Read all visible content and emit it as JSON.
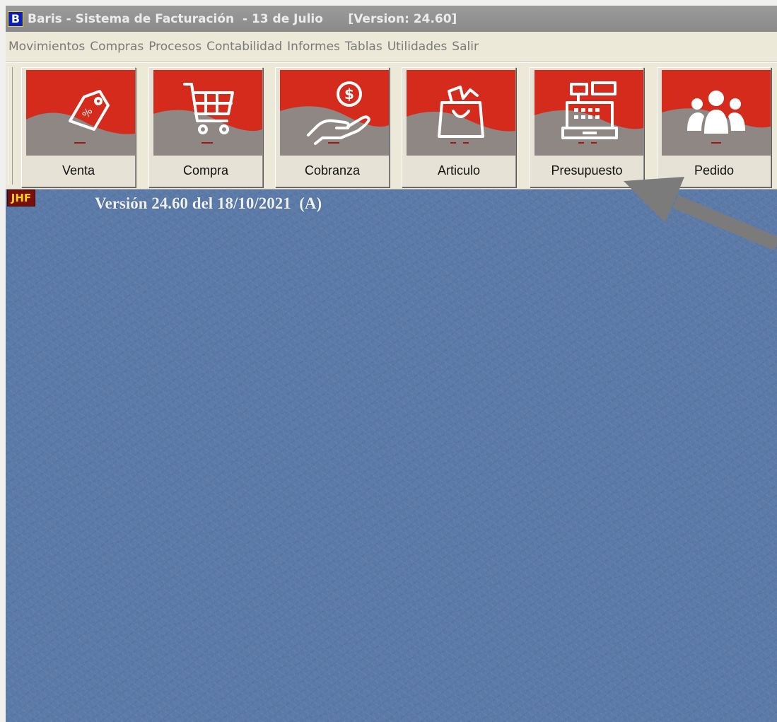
{
  "window": {
    "app_icon_letter": "B",
    "title": "Baris - Sistema de Facturación  - 13 de Julio      [Version: 24.60]"
  },
  "menu": {
    "items": [
      "Movimientos",
      "Compras",
      "Procesos",
      "Contabilidad",
      "Informes",
      "Tablas",
      "Utilidades",
      "Salir"
    ]
  },
  "toolbar": {
    "buttons": [
      {
        "label": "Venta",
        "icon": "price-tag-icon"
      },
      {
        "label": "Compra",
        "icon": "shopping-cart-icon"
      },
      {
        "label": "Cobranza",
        "icon": "coin-hand-icon"
      },
      {
        "label": "Articulo",
        "icon": "shopping-bag-icon"
      },
      {
        "label": "Presupuesto",
        "icon": "cash-register-icon"
      },
      {
        "label": "Pedido",
        "icon": "group-people-icon"
      }
    ]
  },
  "desktop": {
    "logo_text": "JHF",
    "version_text": "Versión 24.60 del 18/10/2021  (A)"
  },
  "colors": {
    "button_red": "#d42b1c",
    "button_gray": "#8f8784",
    "desktop_blue": "#5b7aa8",
    "arrow_gray": "#7b7b7b"
  }
}
